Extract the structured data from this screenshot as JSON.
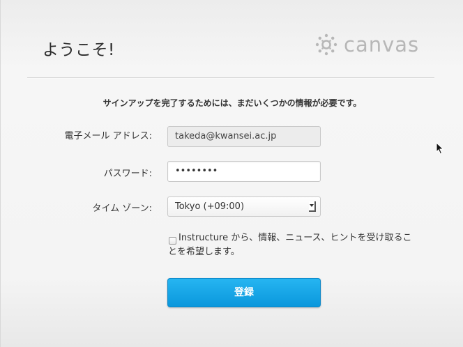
{
  "header": {
    "title": "ようこそ!",
    "logo_text": "canvas"
  },
  "intro": "サインアップを完了するためには、まだいくつかの情報が必要です。",
  "form": {
    "email_label": "電子メール アドレス:",
    "email_value": "takeda@kwansei.ac.jp",
    "password_label": "パスワード:",
    "password_value": "••••••••",
    "timezone_label": "タイム ゾーン:",
    "timezone_value": "Tokyo (+09:00)",
    "optin_text": "Instructure から、情報、ニュース、ヒントを受け取ることを希望します。",
    "submit_label": "登録"
  },
  "colors": {
    "button": "#0a97dc",
    "logo": "#b7b7b7"
  }
}
